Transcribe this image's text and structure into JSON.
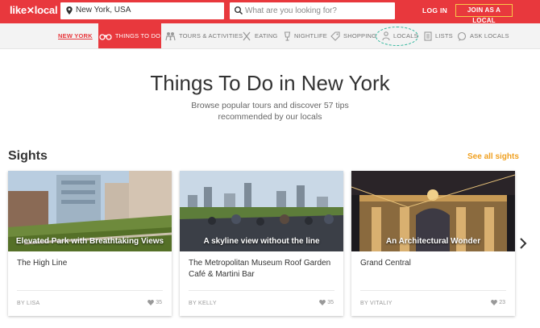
{
  "header": {
    "logo": {
      "prefix": "like",
      "x": "✕",
      "suffix": "local"
    },
    "location_value": "New York, USA",
    "search_placeholder": "What are you looking for?",
    "login_label": "LOG IN",
    "join_label": "JOIN AS A LOCAL"
  },
  "nav": {
    "city": "NEW YORK",
    "items": [
      {
        "label": "THINGS TO DO",
        "icon": "binoculars-icon",
        "active": true
      },
      {
        "label": "TOURS & ACTIVITIES",
        "icon": "people-icon"
      },
      {
        "label": "EATING",
        "icon": "fork-knife-icon"
      },
      {
        "label": "NIGHTLIFE",
        "icon": "drink-icon"
      },
      {
        "label": "SHOPPING",
        "icon": "tag-icon"
      },
      {
        "label": "LOCALS",
        "icon": "person-icon"
      },
      {
        "label": "LISTS",
        "icon": "list-icon"
      },
      {
        "label": "ASK LOCALS",
        "icon": "chat-icon"
      }
    ]
  },
  "hero": {
    "title": "Things To Do in New York",
    "subtitle": "Browse popular tours and discover 57 tips recommended by our locals"
  },
  "sights": {
    "title": "Sights",
    "see_all": "See all sights",
    "cards": [
      {
        "caption": "Elevated Park with Breathtaking Views",
        "name": "The High Line",
        "by": "BY LISA",
        "likes": "35"
      },
      {
        "caption": "A skyline view without the line",
        "name": "The Metropolitan Museum Roof Garden Café & Martini Bar",
        "by": "BY KELLY",
        "likes": "35"
      },
      {
        "caption": "An Architectural Wonder",
        "name": "Grand Central",
        "by": "BY VITALIY",
        "likes": "23"
      }
    ]
  },
  "colors": {
    "brand_red": "#e8383d",
    "accent_orange": "#f0a020",
    "locals_ring": "#2bb59a",
    "join_border": "#f7c948"
  }
}
